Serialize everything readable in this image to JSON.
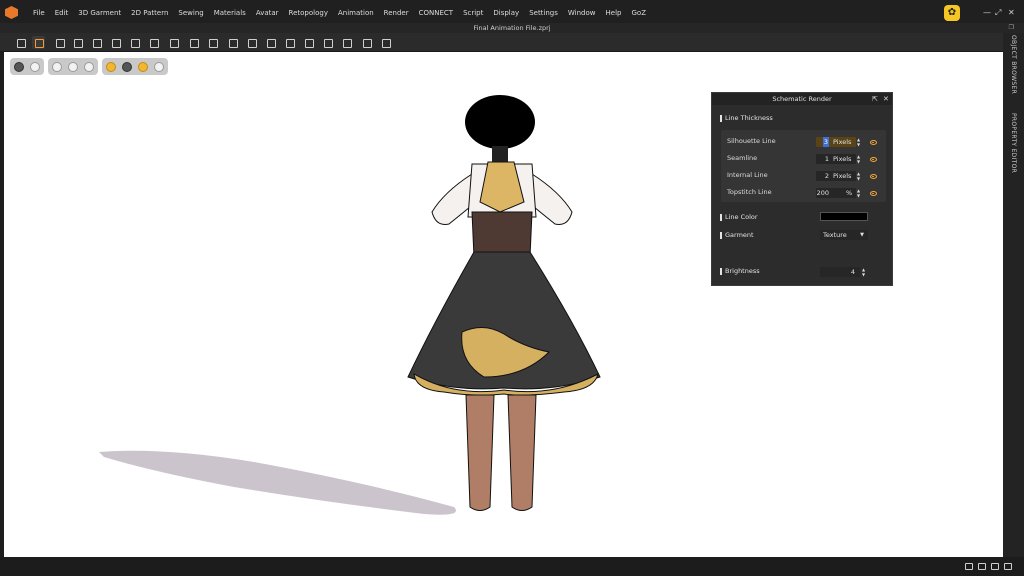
{
  "menubar": {
    "items": [
      "File",
      "Edit",
      "3D Garment",
      "2D Pattern",
      "Sewing",
      "Materials",
      "Avatar",
      "Retopology",
      "Animation",
      "Render",
      "CONNECT",
      "Script",
      "Display",
      "Settings",
      "Window",
      "Help",
      "GoZ"
    ]
  },
  "window": {
    "file_title": "Final Animation File.zprj"
  },
  "right_tabs": {
    "object_browser": "OBJECT BROWSER",
    "property_editor": "PROPERTY EDITOR"
  },
  "schematic_panel": {
    "title": "Schematic Render",
    "line_thickness_label": "Line Thickness",
    "rows": [
      {
        "label": "Silhouette Line",
        "value": "3",
        "unit": "Pixels"
      },
      {
        "label": "Seamline",
        "value": "1",
        "unit": "Pixels"
      },
      {
        "label": "Internal Line",
        "value": "2",
        "unit": "Pixels"
      },
      {
        "label": "Topstitch Line",
        "value": "200",
        "unit": "%"
      }
    ],
    "line_color_label": "Line Color",
    "line_color": "#000000",
    "garment_label": "Garment",
    "garment_value": "Texture",
    "brightness_label": "Brightness",
    "brightness_value": "4"
  },
  "colors": {
    "accent": "#f3a53a",
    "viewport_bg": "#ffffff",
    "panel_bg": "#2c2c2c"
  }
}
